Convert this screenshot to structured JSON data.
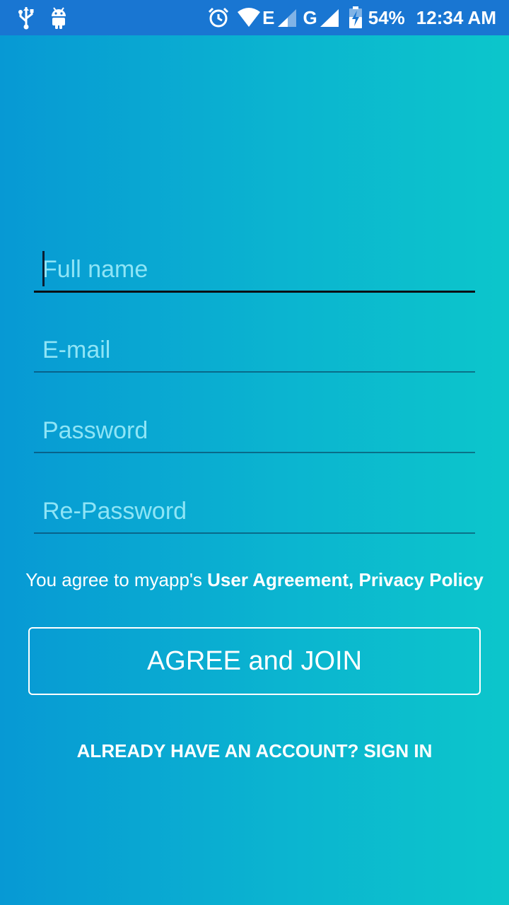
{
  "status_bar": {
    "battery": "54%",
    "time": "12:34 AM",
    "network_e": "E",
    "network_g": "G",
    "icons": [
      "usb-icon",
      "android-debug-icon",
      "alarm-icon",
      "wifi-icon",
      "signal-icon",
      "battery-charging-icon"
    ]
  },
  "form": {
    "full_name": {
      "placeholder": "Full name",
      "value": ""
    },
    "email": {
      "placeholder": "E-mail",
      "value": ""
    },
    "password": {
      "placeholder": "Password",
      "value": ""
    },
    "re_password": {
      "placeholder": "Re-Password",
      "value": ""
    }
  },
  "agreement": {
    "prefix": "You agree to myapp's ",
    "user_agreement": "User Agreement,",
    "privacy_policy": "Privacy Policy"
  },
  "join_button": "AGREE and JOIN",
  "signin_link": "ALREADY HAVE AN ACCOUNT? SIGN IN",
  "colors": {
    "status_bar": "#1976d2",
    "gradient_start": "#0799d4",
    "gradient_end": "#0cc6cb",
    "placeholder": "#96e8f8"
  }
}
